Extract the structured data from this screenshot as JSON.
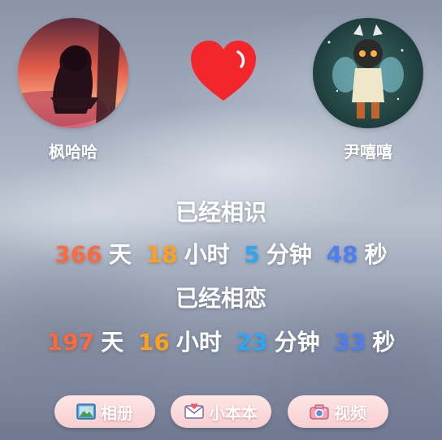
{
  "profiles": {
    "left": {
      "name": "枫哈哈",
      "avatar_icon": "avatar-sunset-character"
    },
    "right": {
      "name": "尹嘻嘻",
      "avatar_icon": "avatar-night-character"
    }
  },
  "heart_icon": "heart-icon",
  "known": {
    "caption": "已经相识",
    "days": "366",
    "days_unit": "天",
    "hours": "18",
    "hours_unit": "小时",
    "minutes": "5",
    "minutes_unit": "分钟",
    "seconds": "48",
    "seconds_unit": "秒"
  },
  "love": {
    "caption": "已经相恋",
    "days": "197",
    "days_unit": "天",
    "hours": "16",
    "hours_unit": "小时",
    "minutes": "23",
    "minutes_unit": "分钟",
    "seconds": "33",
    "seconds_unit": "秒"
  },
  "buttons": {
    "album": {
      "label": "相册",
      "icon": "picture-icon"
    },
    "notebook": {
      "label": "小本本",
      "icon": "envelope-icon"
    },
    "video": {
      "label": "视频",
      "icon": "camera-icon"
    }
  },
  "colors": {
    "days": "#ff6a3d",
    "hours": "#ffa11f",
    "minutes": "#2ba7f5",
    "seconds": "#4b7ff2",
    "heart": "#f5262b"
  }
}
